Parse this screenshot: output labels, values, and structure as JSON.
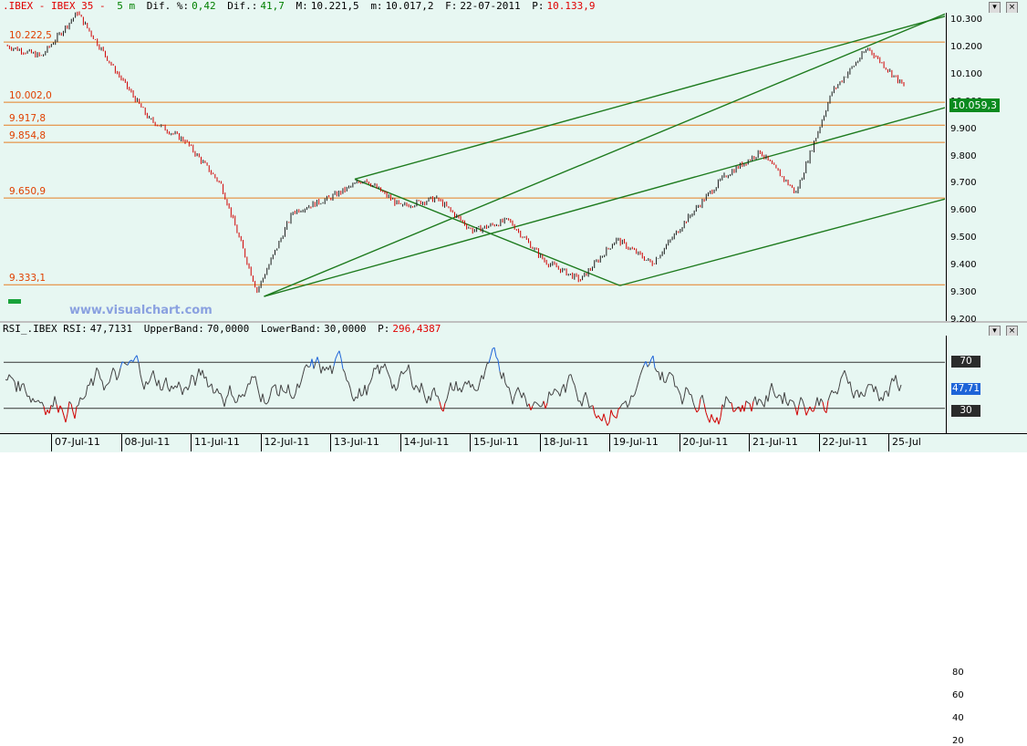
{
  "main_header": {
    "symbol": ".IBEX - IBEX 35 -",
    "interval": "5 m",
    "dif_pct_label": "Dif. %:",
    "dif_pct_value": "0,42",
    "dif_label": "Dif.:",
    "dif_value": "41,7",
    "max_label": "M:",
    "max_value": "10.221,5",
    "min_label": "m:",
    "min_value": "10.017,2",
    "date_label": "F:",
    "date_value": "22-07-2011",
    "price_label": "P:",
    "price_value": "10.133,9"
  },
  "rsi_header": {
    "title": "RSI_.IBEX RSI:",
    "rsi_value": "47,7131",
    "upper_label": "UpperBand:",
    "upper_value": "70,0000",
    "lower_label": "LowerBand:",
    "lower_value": "30,0000",
    "p_label": "P:",
    "p_value": "296,4387"
  },
  "watermark": "www.visualchart.com",
  "window_buttons": [
    "▾",
    "×"
  ],
  "price_axis_ticks": [
    "10.300",
    "10.200",
    "10.100",
    "10.000",
    "9.900",
    "9.800",
    "9.700",
    "9.600",
    "9.500",
    "9.400",
    "9.300",
    "9.200"
  ],
  "current_price_tag": "10.059,3",
  "horizontal_levels": [
    {
      "label": "10.222,5",
      "value": 10222.5
    },
    {
      "label": "10.002,0",
      "value": 10002.0
    },
    {
      "label": "9.917,8",
      "value": 9917.8
    },
    {
      "label": "9.854,8",
      "value": 9854.8
    },
    {
      "label": "9.650,9",
      "value": 9650.9
    },
    {
      "label": "9.333,1",
      "value": 9333.1
    }
  ],
  "rsi_axis_ticks": [
    "80",
    "60",
    "40",
    "20"
  ],
  "rsi_band_tags": {
    "upper": "70",
    "lower": "30",
    "current": "47,71"
  },
  "date_labels": [
    "07-Jul-11",
    "08-Jul-11",
    "11-Jul-11",
    "12-Jul-11",
    "13-Jul-11",
    "14-Jul-11",
    "15-Jul-11",
    "18-Jul-11",
    "19-Jul-11",
    "20-Jul-11",
    "21-Jul-11",
    "22-Jul-11",
    "25-Jul"
  ],
  "colors": {
    "background": "#e7f7f2",
    "level_line": "#e67e22",
    "channel": "#1e7b1e",
    "up_candle": "#1a1a1a",
    "down_candle": "#d00000",
    "rsi_line": "#444444",
    "rsi_over": "#1e64d8",
    "rsi_under": "#d00000",
    "price_tag": "#0a8a1e"
  },
  "chart_data": {
    "type": "line",
    "title": ".IBEX - IBEX 35",
    "ylim": [
      9200,
      10330
    ],
    "price_path": [
      {
        "x": "07-Jul-11",
        "y": 10210
      },
      {
        "x": "07-Jul-11",
        "y": 10170
      },
      {
        "x": "08-Jul-11",
        "y": 10330
      },
      {
        "x": "08-Jul-11",
        "y": 10130
      },
      {
        "x": "08-Jul-11",
        "y": 9940
      },
      {
        "x": "11-Jul-11",
        "y": 9860
      },
      {
        "x": "11-Jul-11",
        "y": 9700
      },
      {
        "x": "12-Jul-11",
        "y": 9310
      },
      {
        "x": "12-Jul-11",
        "y": 9600
      },
      {
        "x": "13-Jul-11",
        "y": 9650
      },
      {
        "x": "13-Jul-11",
        "y": 9720
      },
      {
        "x": "14-Jul-11",
        "y": 9620
      },
      {
        "x": "14-Jul-11",
        "y": 9650
      },
      {
        "x": "15-Jul-11",
        "y": 9530
      },
      {
        "x": "15-Jul-11",
        "y": 9570
      },
      {
        "x": "18-Jul-11",
        "y": 9420
      },
      {
        "x": "18-Jul-11",
        "y": 9350
      },
      {
        "x": "19-Jul-11",
        "y": 9500
      },
      {
        "x": "19-Jul-11",
        "y": 9410
      },
      {
        "x": "20-Jul-11",
        "y": 9580
      },
      {
        "x": "20-Jul-11",
        "y": 9730
      },
      {
        "x": "21-Jul-11",
        "y": 9820
      },
      {
        "x": "21-Jul-11",
        "y": 9670
      },
      {
        "x": "21-Jul-11",
        "y": 10040
      },
      {
        "x": "22-Jul-11",
        "y": 10200
      },
      {
        "x": "22-Jul-11",
        "y": 10060
      }
    ],
    "rsi_bands": {
      "upper": 70,
      "lower": 30
    },
    "rsi_ylim": [
      10,
      90
    ]
  }
}
